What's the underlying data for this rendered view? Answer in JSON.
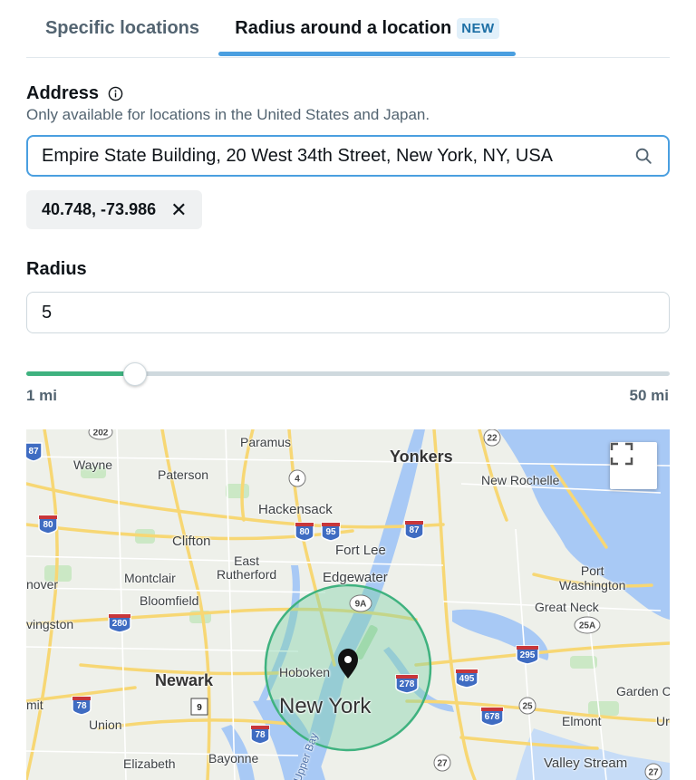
{
  "tabs": [
    {
      "label": "Specific locations"
    },
    {
      "label": "Radius around a location",
      "badge": "NEW"
    }
  ],
  "address": {
    "label": "Address",
    "hint": "Only available for locations in the United States and Japan.",
    "value": "Empire State Building, 20 West 34th Street, New York, NY, USA",
    "chip": "40.748, -73.986"
  },
  "radius": {
    "label": "Radius",
    "value": "5",
    "min_label": "1 mi",
    "max_label": "50 mi",
    "min": 1,
    "max": 50,
    "current": 5
  },
  "map": {
    "places": {
      "paramus": "Paramus",
      "wayne": "Wayne",
      "paterson": "Paterson",
      "yonkers": "Yonkers",
      "new_rochelle": "New Rochelle",
      "hackensack": "Hackensack",
      "clifton": "Clifton",
      "fort_lee": "Fort Lee",
      "east_rutherford": "East\nRutherford",
      "montclair": "Montclair",
      "edgewater": "Edgewater",
      "port_washington": "Port\nWashington",
      "nover": "nover",
      "bloomfield": "Bloomfield",
      "great_neck": "Great Neck",
      "livingston": "vingston",
      "hoboken": "Hoboken",
      "newark": "Newark",
      "new_york": "New York",
      "garden_city": "Garden C",
      "mit": "mit",
      "union": "Union",
      "elmont": "Elmont",
      "ur": "Ur",
      "elizabeth": "Elizabeth",
      "bayonne": "Bayonne",
      "valley_stream": "Valley Stream",
      "upper_bay": "Upper Bay"
    },
    "shields": {
      "s202": "202",
      "s87a": "87",
      "s22": "22",
      "s4": "4",
      "s80a": "80",
      "s80b": "80",
      "s95": "95",
      "s87b": "87",
      "s9a": "9A",
      "s280": "280",
      "s25a": "25A",
      "s295": "295",
      "s278": "278",
      "s495": "495",
      "s78a": "78",
      "s9": "9",
      "s25": "25",
      "s678": "678",
      "s78b": "78",
      "s27a": "27",
      "s27b": "27"
    }
  },
  "colors": {
    "accent": "#4a9fe0",
    "slider_fill": "#3fb27f",
    "radius_circle": "#3fb27f",
    "water": "#a8c9f5",
    "park": "#cbe8c5",
    "road": "#f7d774"
  }
}
